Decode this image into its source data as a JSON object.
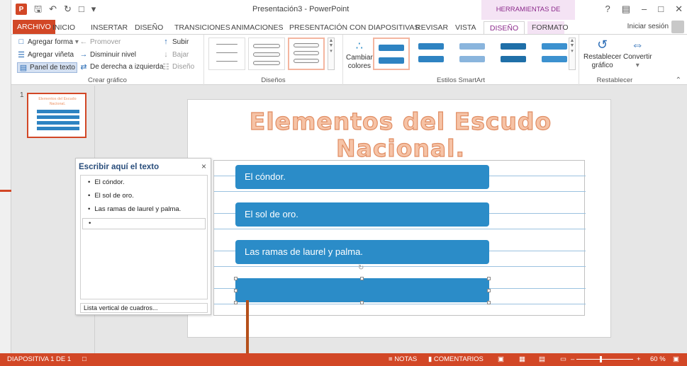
{
  "app": {
    "window_title": "Presentación3 - PowerPoint",
    "contextual_group": "HERRAMIENTAS DE SMARTART",
    "logo_letter": "P",
    "signin": "Iniciar sesión"
  },
  "tabs": [
    "ARCHIVO",
    "INICIO",
    "INSERTAR",
    "DISEÑO",
    "TRANSICIONES",
    "ANIMACIONES",
    "PRESENTACIÓN CON DIAPOSITIVAS",
    "REVISAR",
    "VISTA",
    "DISEÑO",
    "FORMATO"
  ],
  "ribbon": {
    "crear_grafico": {
      "label": "Crear gráfico",
      "agregar_forma": "Agregar forma",
      "agregar_vineta": "Agregar viñeta",
      "panel_texto": "Panel de texto",
      "promover": "Promover",
      "disminuir_nivel": "Disminuir nivel",
      "derecha_izquierda": "De derecha a izquierda",
      "subir": "Subir",
      "bajar": "Bajar",
      "diseno": "Diseño"
    },
    "disenos": {
      "label": "Diseños"
    },
    "estilos": {
      "label": "Estilos SmartArt",
      "cambiar_colores_1": "Cambiar",
      "cambiar_colores_2": "colores"
    },
    "restablecer": {
      "label": "Restablecer",
      "restablecer_grafico_1": "Restablecer",
      "restablecer_grafico_2": "gráfico",
      "convertir": "Convertir"
    }
  },
  "thumbnails": {
    "slide_number": "1",
    "mini_title": "Elementos del Escudo Nacional."
  },
  "slide": {
    "title_line1": "Elementos del Escudo",
    "title_line2": "Nacional.",
    "items": [
      "El cóndor.",
      "El sol de oro.",
      "Las ramas de laurel y palma.",
      ""
    ]
  },
  "text_pane": {
    "title": "Escribir aquí el texto",
    "close": "×",
    "bullets": [
      "El cóndor.",
      "El sol de oro.",
      "Las ramas de laurel y palma.",
      ""
    ],
    "footer": "Lista vertical de cuadros..."
  },
  "status": {
    "slide_info": "DIAPOSITIVA 1 DE 1",
    "notas": "NOTAS",
    "comentarios": "COMENTARIOS",
    "zoom": "60 %"
  },
  "colors": {
    "accent": "#d24726",
    "smartart_box": "#2b8cc8",
    "title_fill": "#f6c3a6",
    "contextual": "#8b2a8b"
  }
}
